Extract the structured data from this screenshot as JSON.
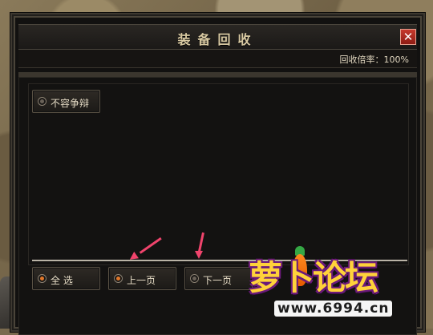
{
  "window": {
    "title": "装备回收"
  },
  "rate": {
    "text": "回收倍率：100%"
  },
  "options": {
    "no_dispute": "不容争辩"
  },
  "buttons": {
    "select_all": "全  选",
    "prev_page": "上一页",
    "next_page": "下一页"
  },
  "watermark": {
    "logo": "萝卜论坛",
    "url": "www.6994.cn"
  },
  "colors": {
    "accent_arrow": "#f0446c",
    "title_text": "#d8c9a2",
    "close_red": "#c63a2e"
  },
  "icons": {
    "close": "close-icon",
    "radio": "radio-icon"
  }
}
